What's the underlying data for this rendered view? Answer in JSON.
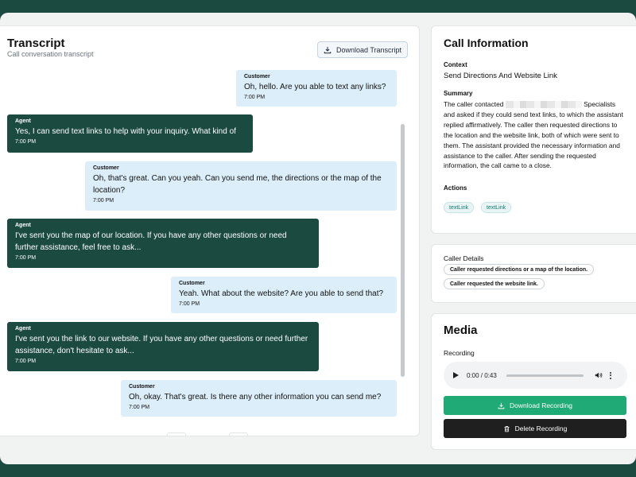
{
  "transcript": {
    "title": "Transcript",
    "subtitle": "Call conversation transcript",
    "download_label": "Download Transcript",
    "messages": [
      {
        "role": "Customer",
        "text": "Oh, hello. Are you able to text any links?",
        "time": "7:00 PM"
      },
      {
        "role": "Agent",
        "text": "Yes, I can send text links to help with your inquiry. What kind of",
        "time": "7:00 PM"
      },
      {
        "role": "Customer",
        "text": "Oh, that's great. Can you yeah. Can you send me, the directions or the map of the location?",
        "time": "7:00 PM"
      },
      {
        "role": "Agent",
        "text": "I've sent you the map of our location. If you have any other questions or need further assistance, feel free to ask...",
        "time": "7:00 PM"
      },
      {
        "role": "Customer",
        "text": "Yeah. What about the website? Are you able to send that?",
        "time": "7:00 PM"
      },
      {
        "role": "Agent",
        "text": "I've sent you the link to our website. If you have any other questions or need further assistance, don't hesitate to ask...",
        "time": "7:00 PM"
      },
      {
        "role": "Customer",
        "text": "Oh, okay. That's great. Is there any other information you can send me?",
        "time": "7:00 PM"
      }
    ]
  },
  "call_info": {
    "title": "Call Information",
    "context_label": "Context",
    "context_value": "Send Directions And Website Link",
    "summary_label": "Summary",
    "summary_pre": "The caller contacted",
    "summary_post": "Specialists and asked if they could send text links, to which the assistant replied affirmatively. The caller then requested directions to the location and the website link, both of which were sent to them. The assistant provided the necessary information and assistance to the caller. After sending the requested information, the call came to a close.",
    "actions_label": "Actions",
    "actions": [
      "textLink",
      "textLink"
    ]
  },
  "caller_details": {
    "label": "Caller Details",
    "items": [
      "Caller requested directions or a map of the location.",
      "Caller requested the website link."
    ]
  },
  "media": {
    "title": "Media",
    "recording_label": "Recording",
    "time": "0:00 / 0:43",
    "progress": 0.0,
    "download_label": "Download Recording",
    "delete_label": "Delete Recording"
  },
  "colors": {
    "agent_bubble": "#1b4a40",
    "customer_bubble": "#dceef9",
    "download_recording": "#1faa76",
    "delete_recording": "#1f1f1f"
  }
}
